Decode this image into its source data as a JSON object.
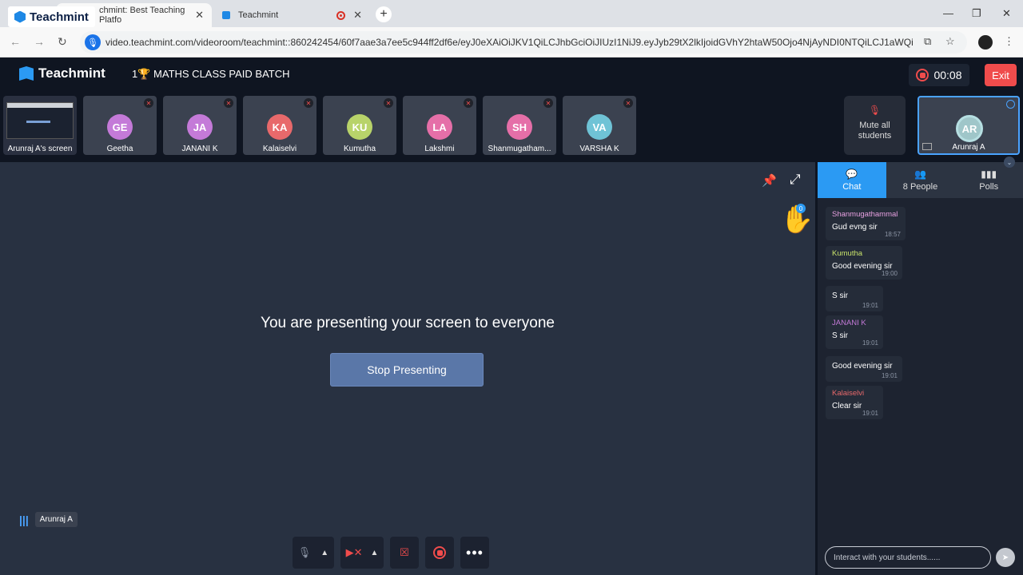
{
  "browser": {
    "brand_overlay": "Teachmint",
    "tabs": [
      {
        "title": "chmint: Best Teaching Platfo"
      },
      {
        "title": "Teachmint"
      }
    ],
    "url": "video.teachmint.com/videoroom/teachmint::860242454/60f7aae3a7ee5c944ff2df6e/eyJ0eXAiOiJKV1QiLCJhbGciOiJIUzI1NiJ9.eyJyb29tX2lkIjoidGVhY2htaW50Ojo4NjAyNDI0NTQiLCJ1aWQiOiI2MGY..."
  },
  "header": {
    "logo": "Teachmint",
    "class_name": "1🏆 MATHS CLASS PAID BATCH",
    "timer": "00:08",
    "exit_label": "Exit"
  },
  "participants": [
    {
      "initials": "",
      "name": "Arunraj A's screen"
    },
    {
      "initials": "GE",
      "name": "Geetha",
      "color": "#c47ad8"
    },
    {
      "initials": "JA",
      "name": "JANANI K",
      "color": "#c47ad8"
    },
    {
      "initials": "KA",
      "name": "Kalaiselvi",
      "color": "#e8696b"
    },
    {
      "initials": "KU",
      "name": "Kumutha",
      "color": "#b8d36a"
    },
    {
      "initials": "LA",
      "name": "Lakshmi",
      "color": "#e56fa8"
    },
    {
      "initials": "SH",
      "name": "Shanmugatham...",
      "color": "#e56fa8"
    },
    {
      "initials": "VA",
      "name": "VARSHA K",
      "color": "#6fc3d6"
    }
  ],
  "mute_all": {
    "label": "Mute all students"
  },
  "host": {
    "initials": "AR",
    "name": "Arunraj A"
  },
  "stage": {
    "hand_count": "0",
    "message": "You are presenting your screen to everyone",
    "stop_label": "Stop Presenting",
    "speaker": "Arunraj A"
  },
  "panel": {
    "tabs": [
      {
        "label": "Chat",
        "icon": "chat-icon"
      },
      {
        "label": "8 People",
        "icon": "people-icon"
      },
      {
        "label": "Polls",
        "icon": "polls-icon"
      }
    ],
    "messages": [
      {
        "from": "Shanmugathammal",
        "color": "#e6a0e0",
        "text": "Gud evng sir",
        "time": "18:57"
      },
      {
        "from": "Kumutha",
        "color": "#c9e36b",
        "text": "Good evening sir",
        "time": "19:00"
      },
      {
        "from": "",
        "color": "",
        "text": "S sir",
        "time": "19:01"
      },
      {
        "from": "JANANI K",
        "color": "#c47ad8",
        "text": "S sir",
        "time": "19:01"
      },
      {
        "from": "",
        "color": "",
        "text": "Good evening sir",
        "time": "19:01"
      },
      {
        "from": "Kalaiselvi",
        "color": "#e8696b",
        "text": "Clear sir",
        "time": "19:01"
      }
    ],
    "input_placeholder": "Interact with your students......"
  }
}
